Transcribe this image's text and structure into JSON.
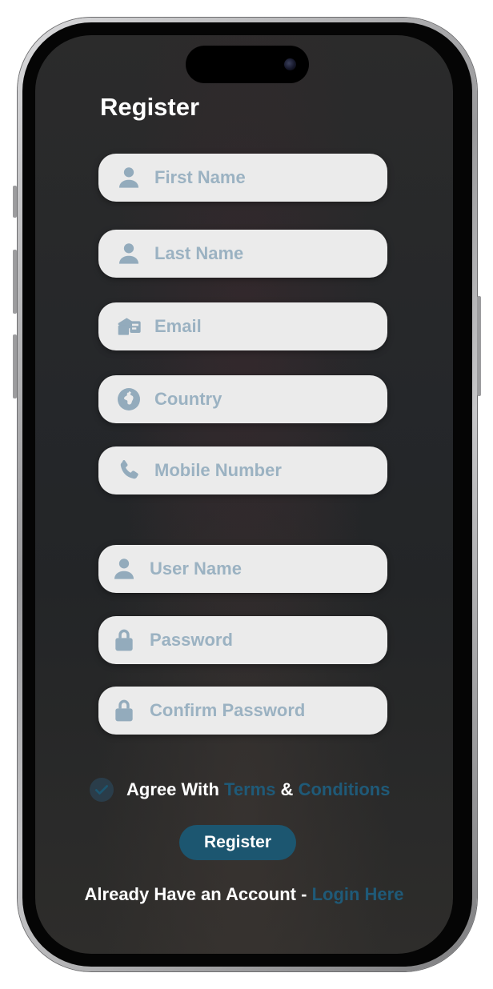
{
  "page": {
    "title": "Register"
  },
  "form": {
    "fields": [
      {
        "placeholder": "First Name",
        "icon": "user-icon",
        "value": ""
      },
      {
        "placeholder": "Last Name",
        "icon": "user-icon",
        "value": ""
      },
      {
        "placeholder": "Email",
        "icon": "mail-icon",
        "value": ""
      },
      {
        "placeholder": "Country",
        "icon": "globe-icon",
        "value": ""
      },
      {
        "placeholder": "Mobile Number",
        "icon": "phone-icon",
        "value": ""
      },
      {
        "placeholder": "User Name",
        "icon": "user-icon",
        "value": ""
      },
      {
        "placeholder": "Password",
        "icon": "lock-icon",
        "value": ""
      },
      {
        "placeholder": "Confirm Password",
        "icon": "lock-icon",
        "value": ""
      }
    ]
  },
  "agreement": {
    "checked": true,
    "prefix": "Agree With ",
    "terms": "Terms",
    "and": " & ",
    "conditions": "Conditions"
  },
  "actions": {
    "register_label": "Register"
  },
  "footer": {
    "prefix": "Already Have an Account - ",
    "login_link": "Login Here"
  },
  "colors": {
    "screen_bg": "#2a2b2c",
    "field_bg": "#ebebeb",
    "placeholder": "#9bb2c2",
    "icon": "#93abbc",
    "accent": "#1c5670",
    "link": "#1f5a78"
  }
}
